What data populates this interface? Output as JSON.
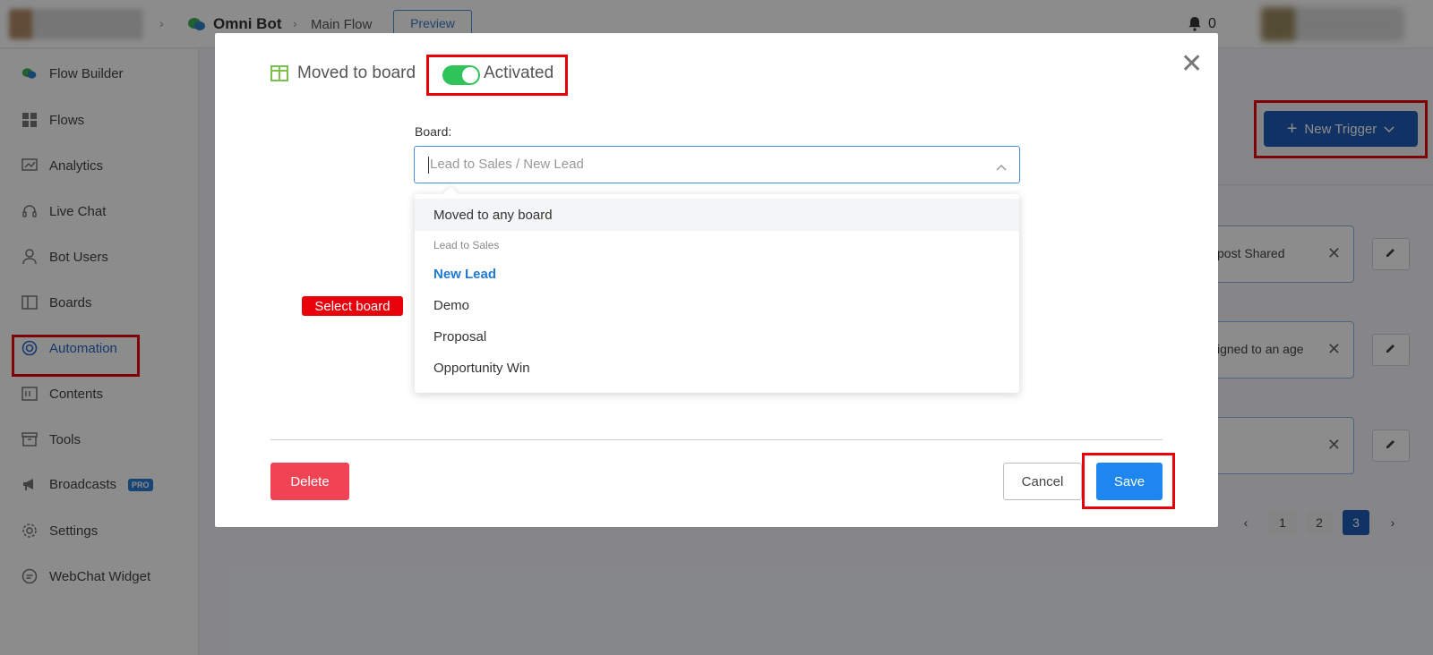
{
  "header": {
    "bot_name": "Omni Bot",
    "flow_name": "Main Flow",
    "preview_label": "Preview",
    "notification_count": "0"
  },
  "sidebar": {
    "items": [
      {
        "label": "Flow Builder",
        "icon": "flow-builder-icon"
      },
      {
        "label": "Flows",
        "icon": "grid-icon"
      },
      {
        "label": "Analytics",
        "icon": "chart-icon"
      },
      {
        "label": "Live Chat",
        "icon": "headset-icon"
      },
      {
        "label": "Bot Users",
        "icon": "user-icon"
      },
      {
        "label": "Boards",
        "icon": "board-icon"
      },
      {
        "label": "Automation",
        "icon": "automation-icon",
        "active": true
      },
      {
        "label": "Contents",
        "icon": "contents-icon"
      },
      {
        "label": "Tools",
        "icon": "tools-icon"
      },
      {
        "label": "Broadcasts",
        "icon": "megaphone-icon",
        "badge": "PRO"
      },
      {
        "label": "Settings",
        "icon": "gear-icon"
      },
      {
        "label": "WebChat Widget",
        "icon": "chat-icon"
      }
    ]
  },
  "main": {
    "new_trigger_label": "New Trigger",
    "trigger_cards": [
      {
        "text": "post Shared"
      },
      {
        "text": "igned to an age"
      },
      {
        "text": ""
      }
    ],
    "pagination": [
      "1",
      "2",
      "3"
    ],
    "current_page": "3"
  },
  "modal": {
    "trigger_name": "Moved to board",
    "status_label": "Activated",
    "status_on": true,
    "board_label": "Board:",
    "board_placeholder": "Lead to Sales / New Lead",
    "dropdown": {
      "any_option": "Moved to any board",
      "group_label": "Lead to Sales",
      "options": [
        "New Lead",
        "Demo",
        "Proposal",
        "Opportunity Win"
      ],
      "selected": "New Lead"
    },
    "annotation_label": "Select board",
    "delete_label": "Delete",
    "cancel_label": "Cancel",
    "save_label": "Save"
  },
  "colors": {
    "accent": "#1f5bb8",
    "save": "#1f86f0",
    "delete": "#f04455",
    "toggle_on": "#2ec45a",
    "highlight": "#e8000b"
  }
}
